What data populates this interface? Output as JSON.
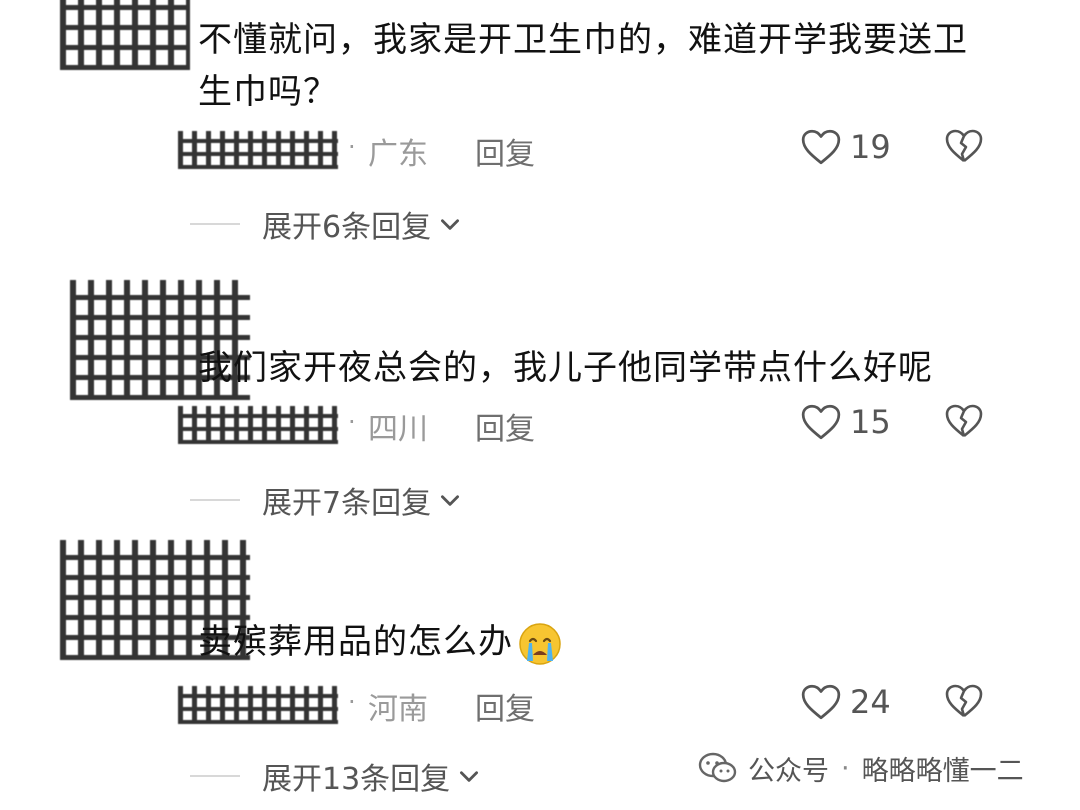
{
  "comments": [
    {
      "text": "不懂就问，我家是开卫生巾的，难道开学我要送卫生巾吗？",
      "region": "广东",
      "reply_label": "回复",
      "likes": "19",
      "expand_label": "展开6条回复"
    },
    {
      "text": "我们家开夜总会的，我儿子他同学带点什么好呢",
      "region": "四川",
      "reply_label": "回复",
      "likes": "15",
      "expand_label": "展开7条回复"
    },
    {
      "text": "卖殡葬用品的怎么办",
      "region": "河南",
      "reply_label": "回复",
      "likes": "24",
      "expand_label": "展开13条回复"
    }
  ],
  "meta_separator": "·",
  "watermark": {
    "platform": "公众号",
    "separator": "·",
    "account": "略略略懂一二"
  },
  "icons": {
    "like": "heart-icon",
    "dislike": "broken-heart-icon",
    "expand": "chevron-down-icon",
    "emoji": "crying-face-icon",
    "wechat": "wechat-icon"
  },
  "colors": {
    "text": "#111111",
    "muted": "#9a9a9a",
    "secondary": "#555555"
  }
}
